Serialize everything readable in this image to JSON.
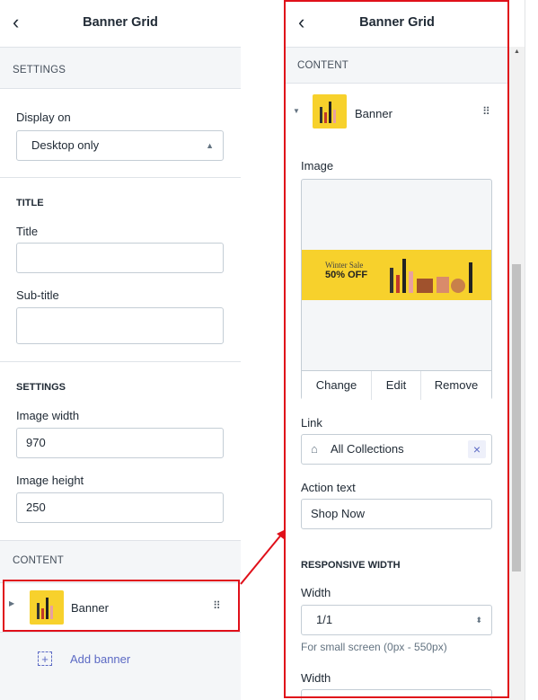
{
  "left": {
    "header": {
      "back": "‹",
      "title": "Banner Grid"
    },
    "settings_section": "SETTINGS",
    "display_on": {
      "label": "Display on",
      "value": "Desktop only"
    },
    "title_heading": "TITLE",
    "title_field": {
      "label": "Title",
      "value": ""
    },
    "subtitle_field": {
      "label": "Sub-title",
      "value": ""
    },
    "settings_heading": "SETTINGS",
    "image_width": {
      "label": "Image width",
      "value": "970"
    },
    "image_height": {
      "label": "Image height",
      "value": "250"
    },
    "content_section": "CONTENT",
    "banner_item": {
      "label": "Banner"
    },
    "add_banner": "Add banner"
  },
  "right": {
    "header": {
      "back": "‹",
      "title": "Banner Grid"
    },
    "content_section": "CONTENT",
    "banner_item": {
      "label": "Banner"
    },
    "image_label": "Image",
    "banner_text_line1": "Winter Sale",
    "banner_text_line2": "50% OFF",
    "image_buttons": [
      "Change",
      "Edit",
      "Remove"
    ],
    "link": {
      "label": "Link",
      "value": "All Collections"
    },
    "action_text": {
      "label": "Action text",
      "value": "Shop Now"
    },
    "responsive_heading": "RESPONSIVE WIDTH",
    "width1": {
      "label": "Width",
      "value": "1/1",
      "help": "For small screen (0px - 550px)"
    },
    "width2": {
      "label": "Width"
    }
  },
  "colors": {
    "highlight": "#e0101a",
    "accent": "#5c6ac4",
    "banner_yellow": "#f7d12c"
  }
}
